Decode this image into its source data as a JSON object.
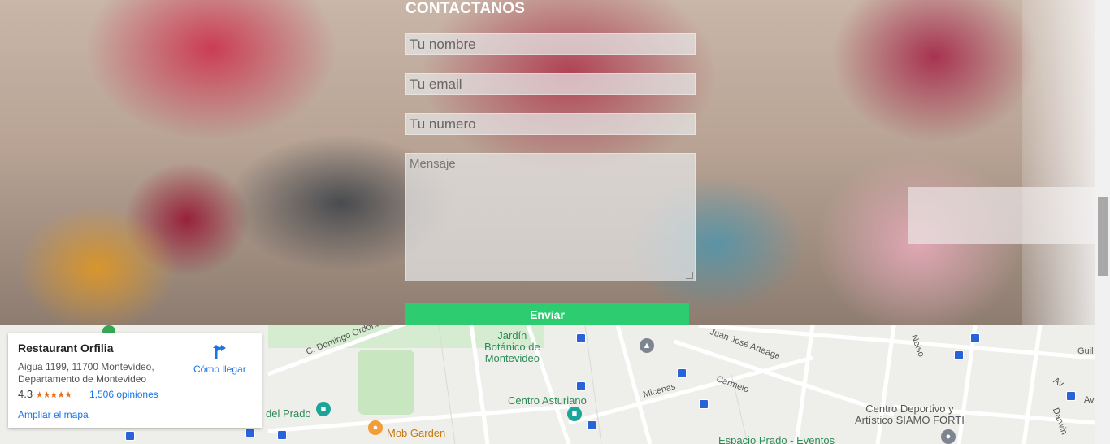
{
  "contact": {
    "title": "CONTACTANOS",
    "name_placeholder": "Tu nombre",
    "email_placeholder": "Tu email",
    "phone_placeholder": "Tu numero",
    "message_placeholder": "Mensaje",
    "send_label": "Enviar"
  },
  "map": {
    "labels": {
      "jardin": "Jardín\nBotánico de\nMontevideo",
      "domingo": "C. Domingo Ordoñana",
      "juan_jose": "Juan José Arteaga",
      "carmelo": "Carmelo",
      "micenas": "Micenas",
      "centro_asturiano": "Centro Asturiano",
      "del_prado": "del Prado",
      "mob_garden": "Mob Garden",
      "centro_deportivo": "Centro Deportivo y\nArtístico SIAMO FORTI",
      "espacio_prado": "Espacio Prado - Eventos",
      "nelson": "Nelso",
      "guil": "Guil",
      "avda": "Av",
      "darwin": "Darwin"
    },
    "card": {
      "name": "Restaurant Orfilia",
      "address": "Aigua 1199, 11700 Montevideo, Departamento de Montevideo",
      "rating": "4.3",
      "stars": "★★★★★",
      "reviews": "1,506 opiniones",
      "directions": "Cómo llegar",
      "larger_map": "Ampliar el mapa"
    }
  },
  "colors": {
    "send_button": "#2ecc71",
    "link": "#1a73e8",
    "star": "#e7711b"
  }
}
